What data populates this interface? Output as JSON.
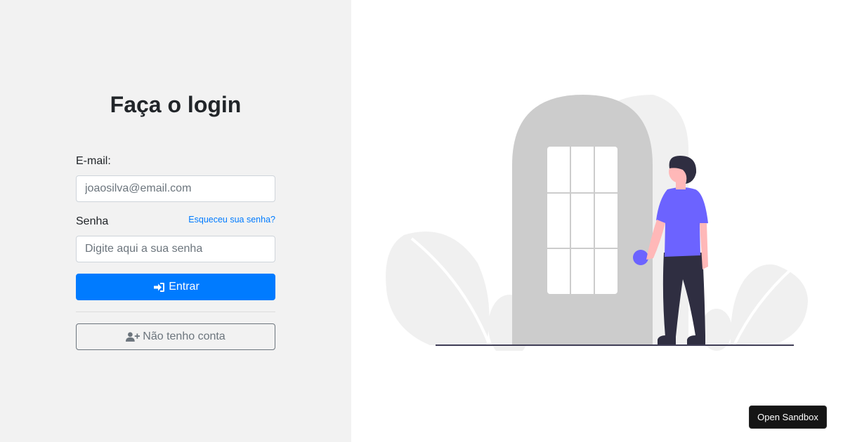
{
  "login": {
    "title": "Faça o login",
    "email_label": "E-mail:",
    "email_placeholder": "joaosilva@email.com",
    "password_label": "Senha",
    "forgot_link": "Esqueceu sua senha?",
    "password_placeholder": "Digite aqui a sua senha",
    "submit_label": "Entrar",
    "register_label": "Não tenho conta",
    "submit_icon": "sign-in-icon",
    "register_icon": "user-plus-icon"
  },
  "sandbox": {
    "label": "Open Sandbox"
  },
  "colors": {
    "left_panel_bg": "#f2f2f2",
    "primary": "#007bff",
    "secondary": "#6c757d",
    "illustration_accent": "#6c63ff"
  }
}
